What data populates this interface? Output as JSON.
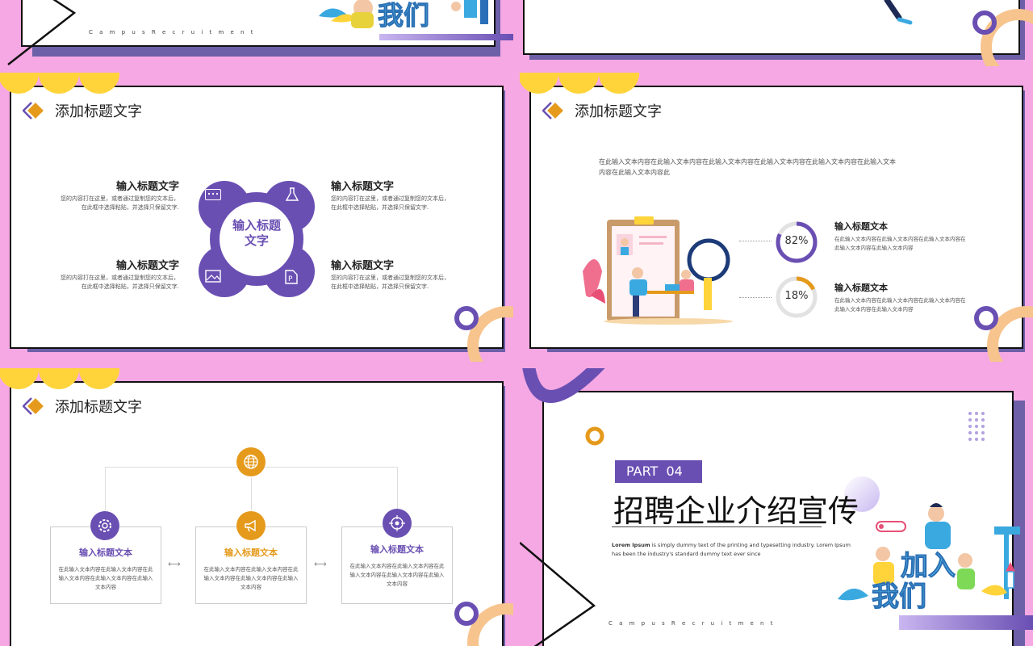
{
  "colors": {
    "pink": "#f5a8e3",
    "purple": "#6a4fb3",
    "orange": "#e59a1c",
    "yellow": "#ffd43b",
    "teal": "#3aa9e0"
  },
  "slide1": {
    "campus_letters": "C  a  m  p  u  s      R  e  c  r  u  i  t  m  e  n  t",
    "hero_text": "我们"
  },
  "slide3": {
    "title": "添加标题文字",
    "center": "输入标题文字",
    "items": [
      {
        "heading": "输入标题文字",
        "body1": "您的内容打在这里，或者通过复制您的文本后，",
        "body2": "在此框中选择粘贴，并选择只保留文字."
      },
      {
        "heading": "输入标题文字",
        "body1": "您的内容打在这里，或者通过复制您的文本后，",
        "body2": "在此框中选择粘贴，并选择只保留文字."
      },
      {
        "heading": "输入标题文字",
        "body1": "您的内容打在这里，或者通过复制您的文本后，",
        "body2": "在此框中选择粘贴，并选择只保留文字."
      },
      {
        "heading": "输入标题文字",
        "body1": "您的内容打在这里，或者通过复制您的文本后，",
        "body2": "在此框中选择粘贴，并选择只保留文字."
      }
    ],
    "icons": [
      "chat-icon",
      "flask-icon",
      "image-icon",
      "document-icon"
    ]
  },
  "slide4": {
    "title": "添加标题文字",
    "intro1": "在此输入文本内容在此输入文本内容在此输入文本内容在此输入文本内容在此输入文本内容在此输入文本",
    "intro2": "内容在此输入文本内容此",
    "stats": [
      {
        "percent": "82%",
        "value": 82,
        "heading": "输入标题文本",
        "body1": "在此输入文本内容在此输入文本内容在此输入文本内容在",
        "body2": "此输入文本内容在此输入文本内容"
      },
      {
        "percent": "18%",
        "value": 18,
        "heading": "输入标题文本",
        "body1": "在此输入文本内容在此输入文本内容在此输入文本内容在",
        "body2": "此输入文本内容在此输入文本内容"
      }
    ]
  },
  "slide5": {
    "title": "添加标题文字",
    "boxes": [
      {
        "heading": "输入标题文本",
        "body1": "在此输入文本内容在此输入文本内容在此",
        "body2": "输入文本内容在此输入文本内容在此输入",
        "body3": "文本内容"
      },
      {
        "heading": "输入标题文本",
        "body1": "在此输入文本内容在此输入文本内容在此",
        "body2": "输入文本内容在此输入文本内容在此输入",
        "body3": "文本内容"
      },
      {
        "heading": "输入标题文本",
        "body1": "在此输入文本内容在此输入文本内容在此",
        "body2": "输入文本内容在此输入文本内容在此输入",
        "body3": "文本内容"
      }
    ],
    "icons": [
      "globe-icon",
      "gear-icon",
      "megaphone-icon",
      "target-icon"
    ]
  },
  "slide6": {
    "part": "PART  04",
    "title": "招聘企业介绍宣传",
    "lorem_bold": "Lorem Ipsum",
    "lorem1": " is simply dummy text of the printing and typesetting industry. Lorem Ipsum",
    "lorem2": "has been the industry's standard dummy text ever since",
    "campus_letters": "C  a  m  p  u  s      R  e  c  r  u  i  t  m  e  n  t",
    "hero_text": "加入我们"
  }
}
